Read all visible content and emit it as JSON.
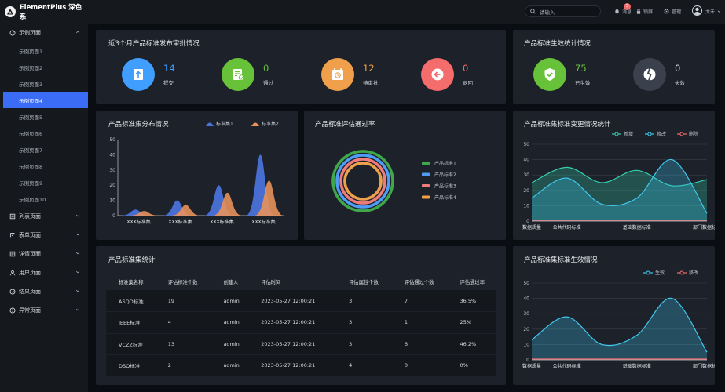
{
  "app": {
    "title": "ElementPlus 深色系"
  },
  "colors": {
    "accent": "#3b6cf6",
    "bg": "#0a0d12",
    "card": "#1d2129",
    "sidebar": "#15181d"
  },
  "header": {
    "search_placeholder": "请输入",
    "message_label": "消息",
    "message_badge": "5",
    "lock_label": "锁屏",
    "admin_label": "管理",
    "user_name": "大禾"
  },
  "sidebar": {
    "groups": [
      {
        "label": "示例页面",
        "icon": "dashboard-icon",
        "expanded": true
      },
      {
        "label": "列表页面",
        "icon": "list-icon"
      },
      {
        "label": "表单页面",
        "icon": "form-icon"
      },
      {
        "label": "详情页面",
        "icon": "detail-icon"
      },
      {
        "label": "用户页面",
        "icon": "user-icon"
      },
      {
        "label": "结果页面",
        "icon": "check-circle-icon"
      },
      {
        "label": "异常页面",
        "icon": "warning-icon"
      }
    ],
    "items": [
      "示例页面1",
      "示例页面2",
      "示例页面3",
      "示例页面4",
      "示例页面5",
      "示例页面6",
      "示例页面7",
      "示例页面8",
      "示例页面9",
      "示例页面10"
    ],
    "active_index": 3
  },
  "approval": {
    "title": "近3个月产品标准发布审批情况",
    "stats": [
      {
        "value": "14",
        "label": "提交",
        "color": "#409eff",
        "icon": "upload-doc-icon"
      },
      {
        "value": "0",
        "label": "通过",
        "color": "#67c23a",
        "icon": "approved-doc-icon"
      },
      {
        "value": "12",
        "label": "待审批",
        "color": "#f0a04b",
        "icon": "pending-doc-icon"
      },
      {
        "value": "0",
        "label": "退回",
        "color": "#f56c6c",
        "icon": "return-icon"
      }
    ]
  },
  "effect": {
    "title": "产品标准生效统计情况",
    "stats": [
      {
        "value": "75",
        "label": "已生效",
        "color": "#67c23a",
        "icon": "shield-check-icon"
      },
      {
        "value": "0",
        "label": "失效",
        "color": "#9aa3b0",
        "icon": "broken-icon"
      }
    ]
  },
  "distribution": {
    "title": "产品标准集分布情况",
    "legend": [
      "标准集1",
      "标准集2"
    ]
  },
  "pass_rate": {
    "title": "产品标准评估通过率",
    "legend": [
      "产品标准1",
      "产品标准2",
      "产品标准3",
      "产品标准4"
    ]
  },
  "change": {
    "title": "产品标准集标准变更情况统计",
    "legend": [
      "新增",
      "修改",
      "删除"
    ]
  },
  "stats_table": {
    "title": "产品标准集统计",
    "columns": [
      "标准集名称",
      "评估标准个数",
      "创建人",
      "评估时间",
      "评估属性个数",
      "评估通过个数",
      "评估通过率"
    ],
    "rows": [
      [
        "ASQD标准",
        "19",
        "admin",
        "2023-05-27 12:00:21",
        "3",
        "7",
        "36.5%"
      ],
      [
        "IEEE标准",
        "4",
        "admin",
        "2023-05-27 12:00:21",
        "3",
        "1",
        "25%"
      ],
      [
        "VCZZ标准",
        "13",
        "admin",
        "2023-05-27 12:00:21",
        "3",
        "6",
        "46.2%"
      ],
      [
        "DSQ标准",
        "2",
        "admin",
        "2023-05-27 12:00:21",
        "4",
        "0",
        "0%"
      ]
    ]
  },
  "effective": {
    "title": "产品标准集标准生效情况",
    "legend": [
      "生效",
      "移改"
    ]
  },
  "chart_data": [
    {
      "type": "area",
      "id": "distribution",
      "title": "产品标准集分布情况",
      "categories": [
        "XXX标准集",
        "XXX标准集",
        "XXX标准集",
        "XXX标准集"
      ],
      "ylim": [
        0,
        50
      ],
      "yticks": [
        "0",
        "10",
        "20",
        "30",
        "40",
        "50"
      ],
      "series": [
        {
          "name": "标准集1",
          "color": "#4a72d9",
          "values": [
            4,
            10,
            20,
            40
          ]
        },
        {
          "name": "标准集2",
          "color": "#e8915a",
          "values": [
            3,
            7,
            15,
            23
          ]
        }
      ]
    },
    {
      "type": "pie",
      "id": "pass_rate",
      "title": "产品标准评估通过率",
      "series": [
        {
          "name": "产品标准1",
          "color": "#3ea84a",
          "value": 100
        },
        {
          "name": "产品标准2",
          "color": "#4e9cf5",
          "value": 100
        },
        {
          "name": "产品标准3",
          "color": "#f07b7b",
          "value": 100
        },
        {
          "name": "产品标准4",
          "color": "#f0a04b",
          "value": 100
        }
      ]
    },
    {
      "type": "line",
      "id": "change",
      "title": "产品标准集标准变更情况统计",
      "categories": [
        "数据质量",
        "公共代码标准",
        "",
        "基础数据标准",
        "",
        "部门数据标准"
      ],
      "ylim": [
        0,
        50
      ],
      "yticks": [
        "0",
        "10",
        "20",
        "30",
        "40",
        "50"
      ],
      "series": [
        {
          "name": "新增",
          "color": "#36cfb0",
          "values": [
            25,
            35,
            25,
            33,
            23,
            27
          ]
        },
        {
          "name": "修改",
          "color": "#3ec9f0",
          "values": [
            15,
            28,
            11,
            15,
            40,
            5
          ]
        },
        {
          "name": "删除",
          "color": "#f06c6c",
          "values": [
            0.5,
            0.5,
            0.5,
            0.5,
            0.5,
            0.5
          ]
        }
      ]
    },
    {
      "type": "line",
      "id": "effective",
      "title": "产品标准集标准生效情况",
      "categories": [
        "数据质量",
        "公共代码标准",
        "",
        "基础数据标准",
        "",
        "部门数据标准"
      ],
      "ylim": [
        0,
        50
      ],
      "yticks": [
        "0",
        "10",
        "20",
        "30",
        "40",
        "50"
      ],
      "series": [
        {
          "name": "生效",
          "color": "#3ec9f0",
          "values": [
            13,
            28,
            10,
            16,
            40,
            5
          ]
        },
        {
          "name": "移改",
          "color": "#f06c6c",
          "values": [
            0.5,
            0.5,
            0.5,
            0.5,
            0.5,
            0.5
          ]
        }
      ]
    }
  ]
}
